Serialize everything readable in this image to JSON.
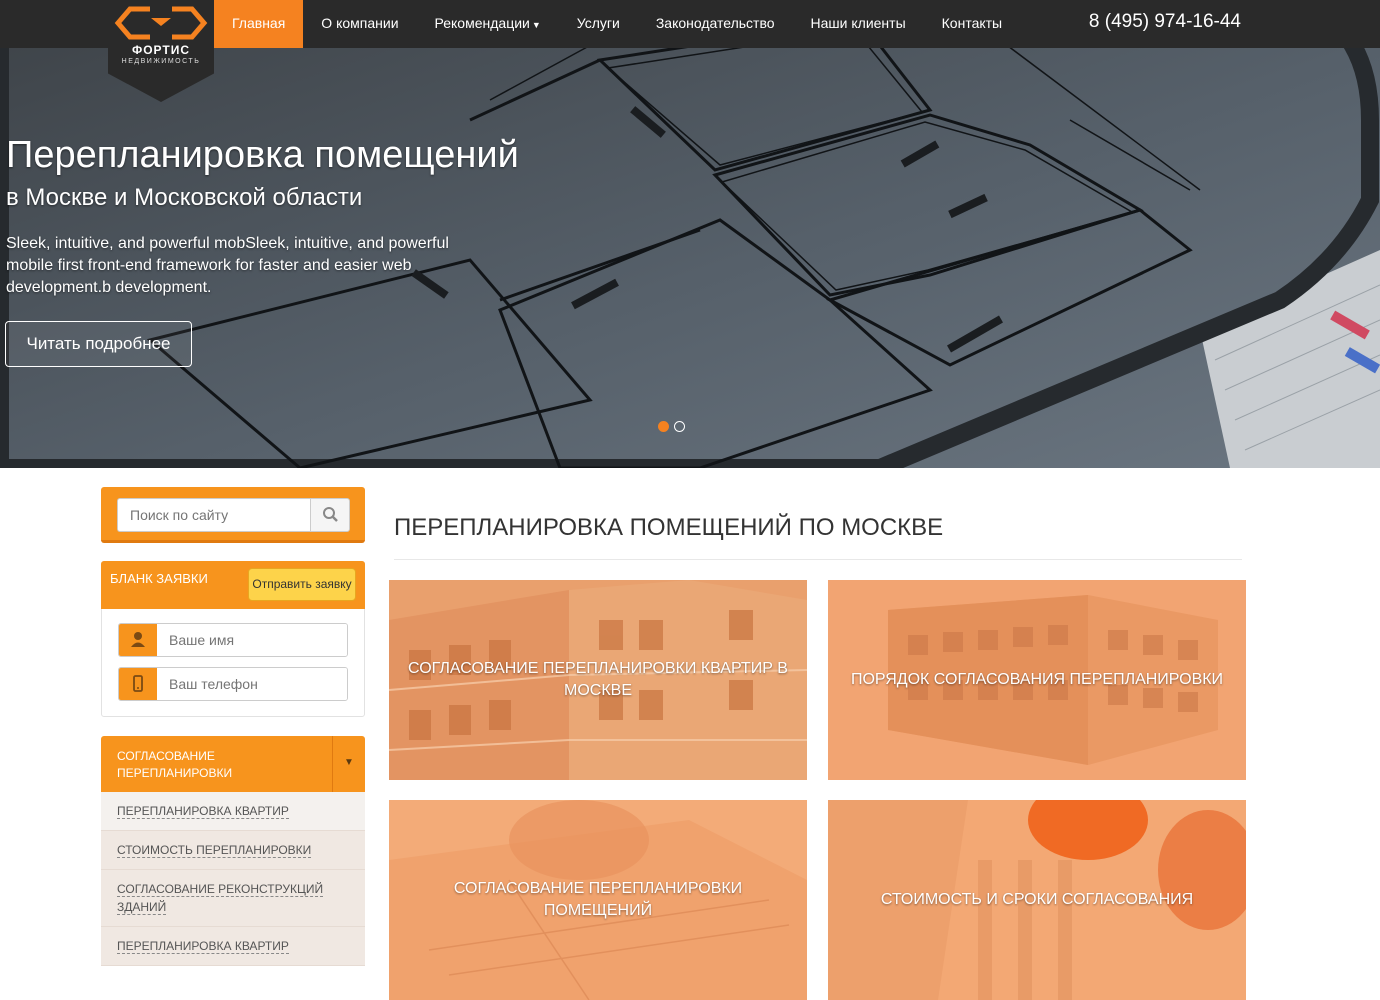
{
  "header": {
    "logo": {
      "name": "ФОРТИС",
      "subtitle": "НЕДВИЖИМОСТЬ"
    },
    "nav": [
      {
        "label": "Главная",
        "active": true
      },
      {
        "label": "О компании"
      },
      {
        "label": "Рекомендации",
        "dropdown": true
      },
      {
        "label": "Услуги"
      },
      {
        "label": "Законодательство"
      },
      {
        "label": "Наши клиенты"
      },
      {
        "label": "Контакты"
      }
    ],
    "phone": "8 (495) 974-16-44"
  },
  "hero": {
    "title": "Перепланировка помещений",
    "subtitle": "в Москве и Московской области",
    "text": "Sleek, intuitive, and powerful mobSleek, intuitive, and powerful mobile first front-end framework for faster and easier web development.b development.",
    "button": "Читать подробнее",
    "slides": 2,
    "active_slide": 1
  },
  "sidebar": {
    "search": {
      "placeholder": "Поиск по сайту",
      "icon": "search-icon"
    },
    "form": {
      "title": "БЛАНК ЗАЯВКИ",
      "send": "Отправить заявку",
      "name_placeholder": "Ваше имя",
      "phone_placeholder": "Ваш телефон"
    },
    "menu": {
      "heading": "СОГЛАСОВАНИЕ ПЕРЕПЛАНИРОВКИ",
      "items": [
        "ПЕРЕПЛАНИРОВКА КВАРТИР",
        "СТОИМОСТЬ ПЕРЕПЛАНИРОВКИ",
        "СОГЛАСОВАНИЕ РЕКОНСТРУКЦИЙ ЗДАНИЙ",
        "ПЕРЕПЛАНИРОВКА КВАРТИР"
      ]
    }
  },
  "main": {
    "title": "ПЕРЕПЛАНИРОВКА ПОМЕЩЕНИЙ ПО МОСКВЕ",
    "tiles": [
      "СОГЛАСОВАНИЕ ПЕРЕПЛАНИРОВКИ КВАРТИР В МОСКВЕ",
      "ПОРЯДОК СОГЛАСОВАНИЯ ПЕРЕПЛАНИРОВКИ",
      "СОГЛАСОВАНИЕ ПЕРЕПЛАНИРОВКИ ПОМЕЩЕНИЙ",
      "СТОИМОСТЬ И СРОКИ СОГЛАСОВАНИЯ"
    ]
  },
  "colors": {
    "accent": "#f58220",
    "navbar": "#2a2a2a",
    "tile_overlay": "#f7a067"
  }
}
